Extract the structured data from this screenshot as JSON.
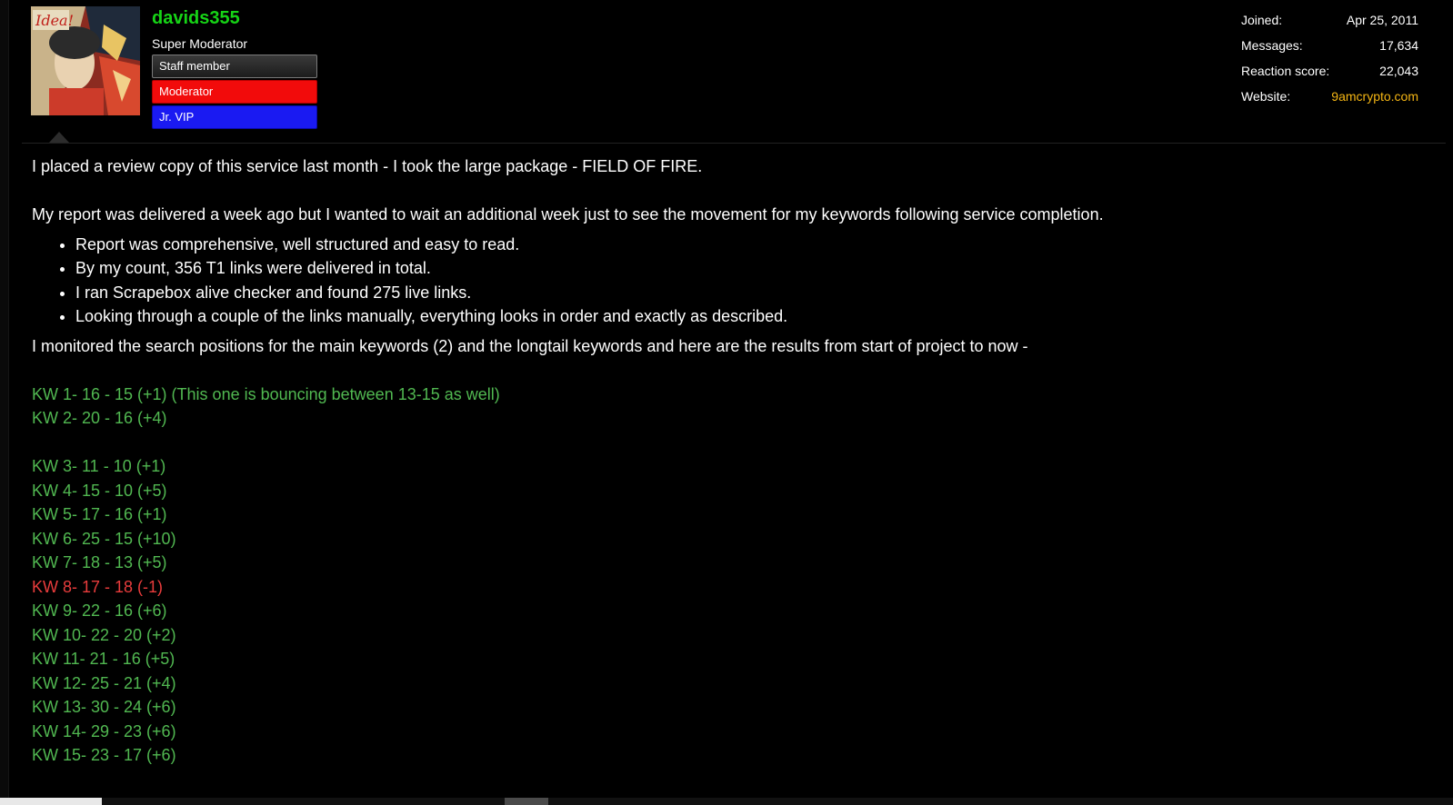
{
  "user": {
    "username": "davids355",
    "title": "Super Moderator",
    "banners": {
      "staff": "Staff member",
      "moderator": "Moderator",
      "vip": "Jr. VIP"
    },
    "avatar_text": "Idea!",
    "stats": {
      "joined_label": "Joined:",
      "joined_value": "Apr 25, 2011",
      "messages_label": "Messages:",
      "messages_value": "17,634",
      "reaction_label": "Reaction score:",
      "reaction_value": "22,043",
      "website_label": "Website:",
      "website_value": "9amcrypto.com"
    }
  },
  "post": {
    "para1": "I placed a review copy of this service last month - I took the large package - FIELD OF FIRE.",
    "para2": "My report was delivered a week ago but I wanted to wait an additional week just to see the movement for my keywords following service completion.",
    "bullets": [
      "Report was comprehensive, well structured and easy to read.",
      "By my count, 356 T1 links were delivered in total.",
      "I ran Scrapebox alive checker and found 275 live links.",
      "Looking through a couple of the links manually, everything looks in order and exactly as described."
    ],
    "para3": "I monitored the search positions for the main keywords (2) and the longtail keywords and here are the results from start of project to now -",
    "main_keywords": [
      "KW 1- 16 - 15 (+1) (This one is bouncing between 13-15 as well)",
      "KW 2- 20 - 16 (+4)"
    ],
    "longtail_keywords": [
      "KW 3- 11 - 10 (+1)",
      "KW 4- 15 - 10 (+5)",
      "KW 5- 17 - 16 (+1)",
      "KW 6- 25 - 15 (+10)",
      "KW 7- 18 - 13 (+5)",
      "KW 8- 17 - 18 (-1)",
      "KW 9- 22 - 16 (+6)",
      "KW 10- 22 - 20 (+2)",
      "KW 11- 21 - 16 (+5)",
      "KW 12- 25 - 21 (+4)",
      "KW 13- 30 - 24 (+6)",
      "KW 14- 29 - 23 (+6)",
      "KW 15- 23 - 17 (+6)"
    ]
  },
  "colors": {
    "background": "#000000",
    "username": "#16d416",
    "positive": "#51b851",
    "negative": "#e93c3c",
    "link": "#f5b614",
    "moderator_banner": "#f20b0b",
    "vip_banner": "#1a1af2"
  }
}
